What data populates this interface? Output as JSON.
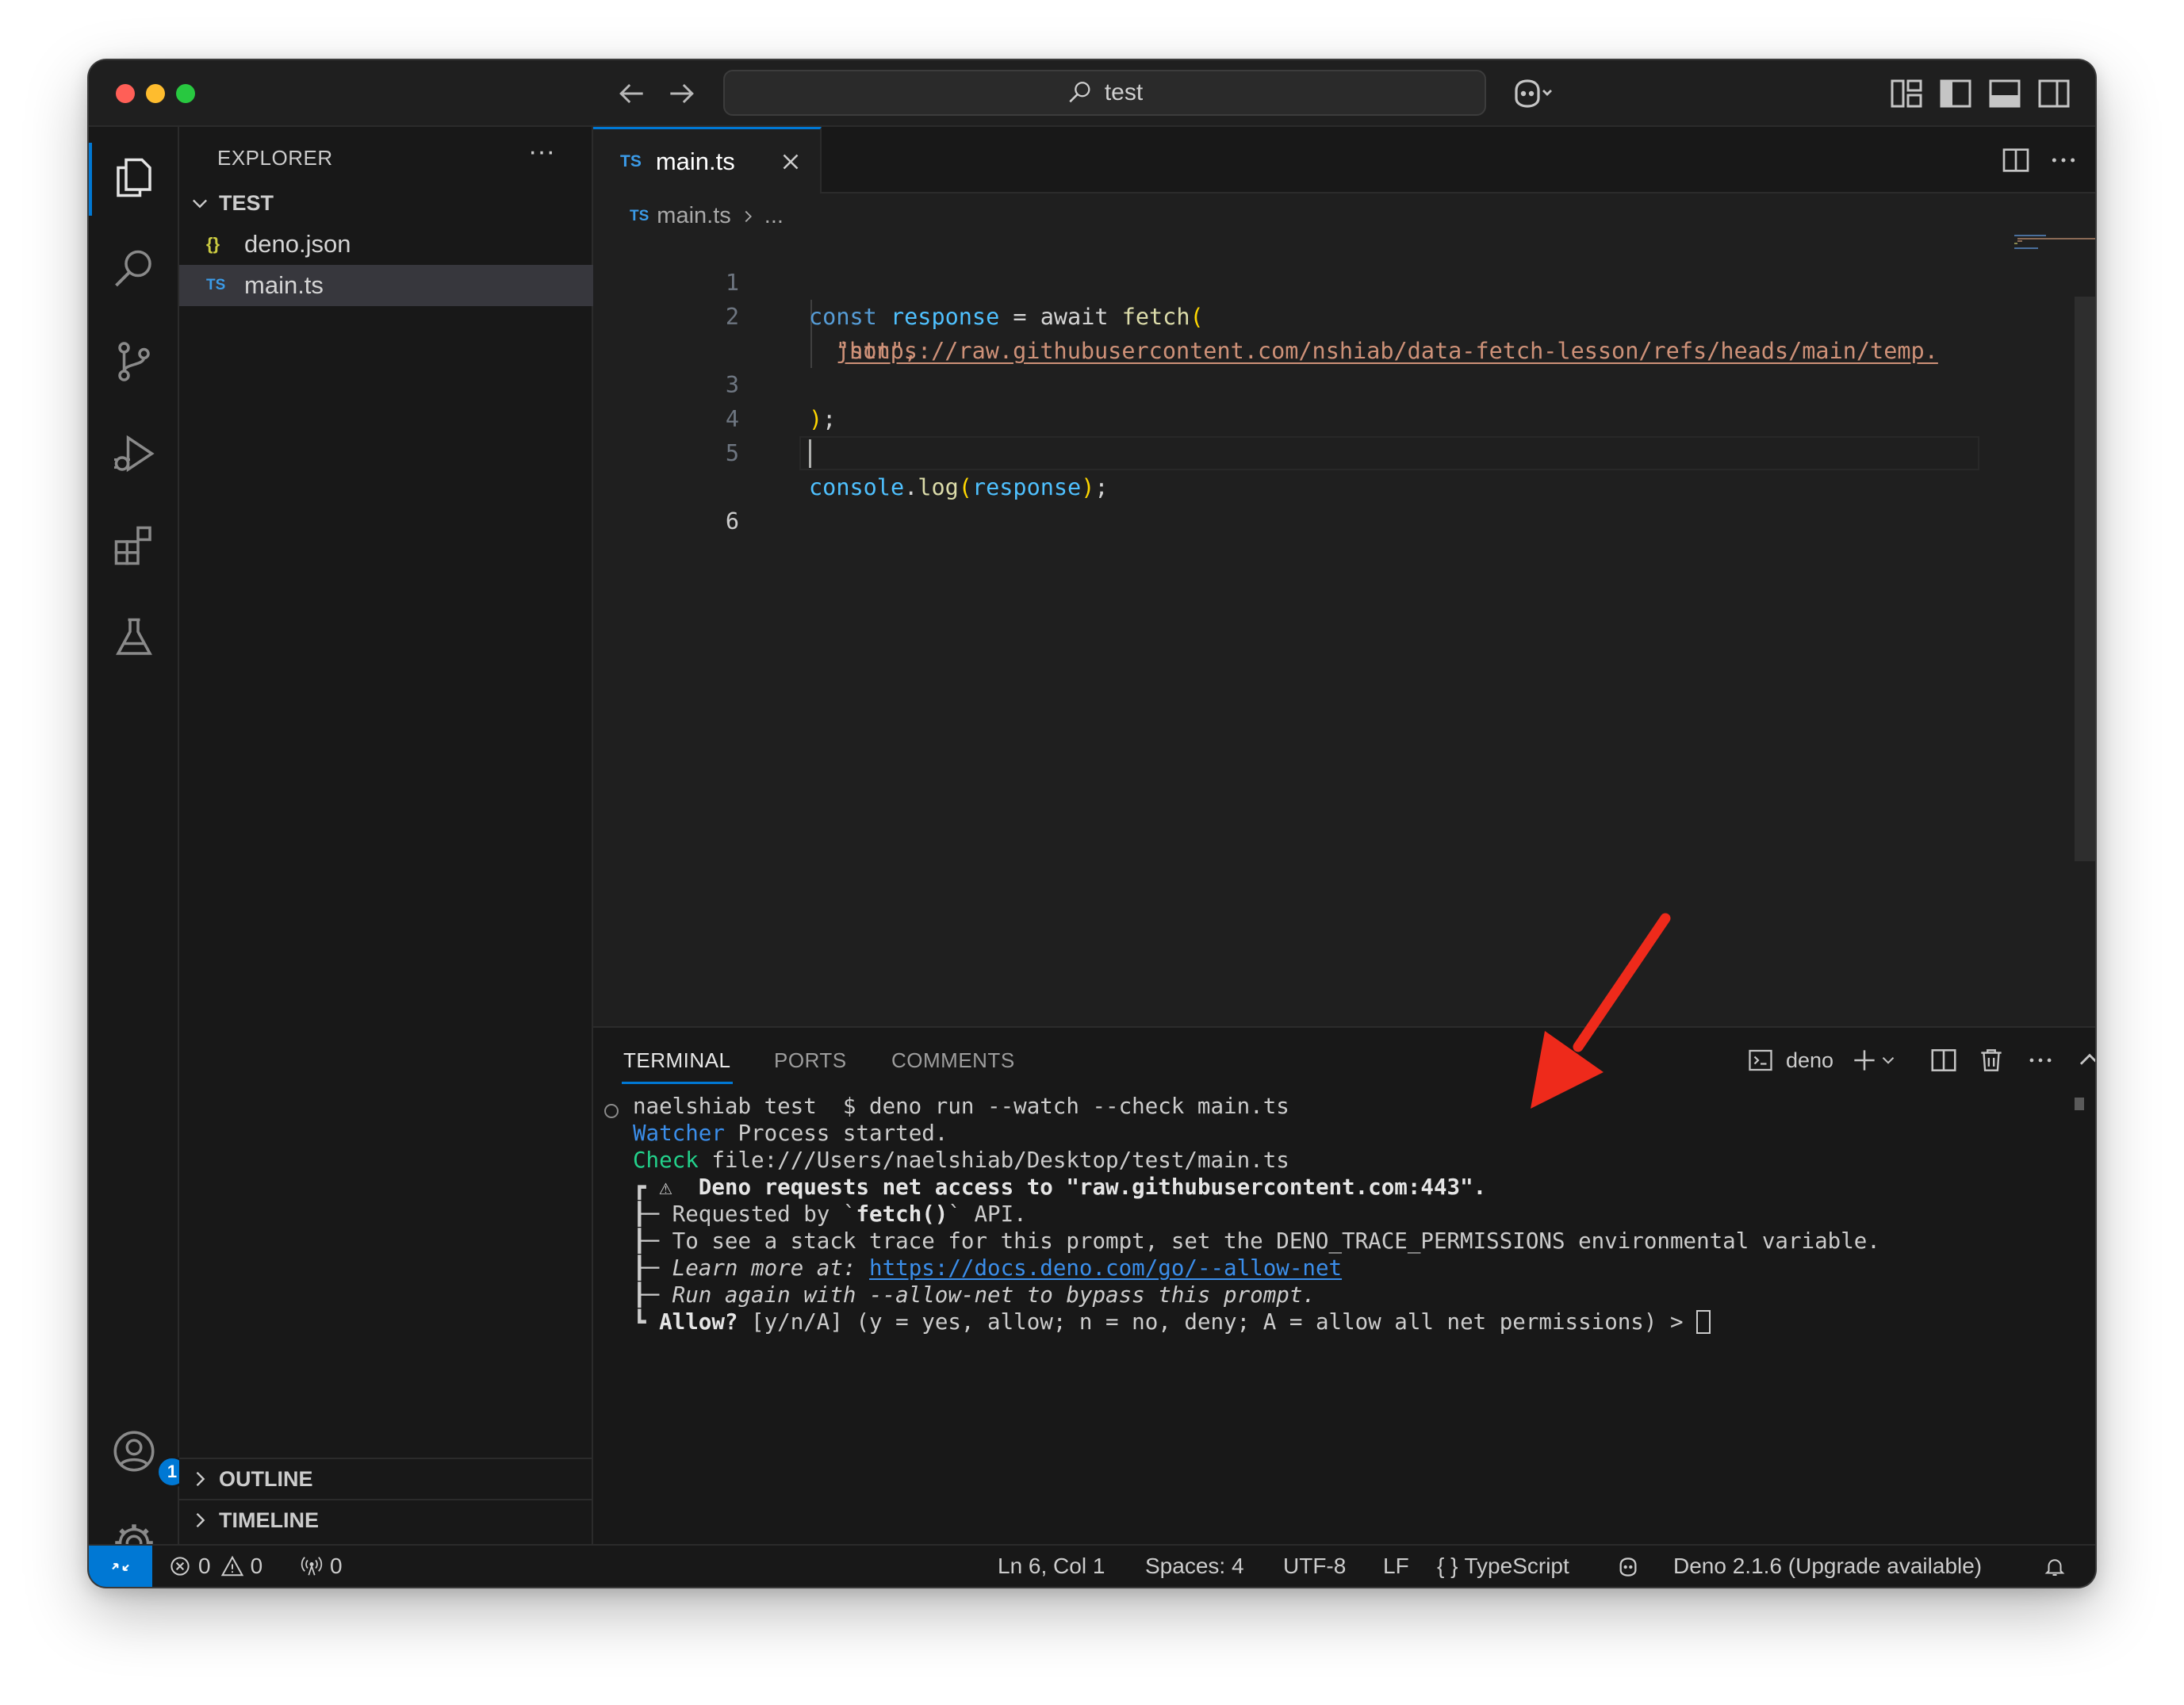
{
  "titlebar": {
    "search_text": "test"
  },
  "activity_bar": {
    "account_badge_count": "1"
  },
  "sidebar": {
    "title": "EXPLORER",
    "more": "···",
    "folder_name": "TEST",
    "files": [
      {
        "name": "deno.json",
        "icon": "{}",
        "icon_color": "#cbcb41"
      },
      {
        "name": "main.ts",
        "icon": "TS",
        "icon_color": "#3b9be8"
      }
    ],
    "outline_label": "OUTLINE",
    "timeline_label": "TIMELINE"
  },
  "editor": {
    "tab_badge": "TS",
    "tab_label": "main.ts",
    "breadcrumb_badge": "TS",
    "breadcrumb_file": "main.ts",
    "breadcrumb_more": "...",
    "line_numbers": [
      "1",
      "2",
      "3",
      "4",
      "5",
      "6"
    ],
    "code": {
      "l1_kw": "const",
      "l1_var": "response",
      "l1_eq": " = await ",
      "l1_fn": "fetch",
      "l1_paren": "(",
      "l2_quote": "\"",
      "l2_url": "https://raw.githubusercontent.com/nshiab/data-fetch-lesson/refs/heads/main/temp.",
      "l2b_url": "json",
      "l2b_rest": "\",",
      "l3_paren": ")",
      "l3_semi": ";",
      "l5_obj": "console",
      "l5_dot": ".",
      "l5_fn": "log",
      "l5_open": "(",
      "l5_var": "response",
      "l5_close": ")",
      "l5_semi": ";"
    }
  },
  "panel": {
    "tabs": [
      "TERMINAL",
      "PORTS",
      "COMMENTS"
    ],
    "active_tab": "TERMINAL",
    "shell_label": "deno",
    "terminal": {
      "line1": "naelshiab test  $ deno run --watch --check main.ts",
      "line2_tag": "Watcher",
      "line2_rest": " Process started.",
      "line3_tag": "Check",
      "line3_rest": " file:///Users/naelshiab/Desktop/test/main.ts",
      "line4_tree": "┏ ⚠  ",
      "line4_text": "Deno requests net access to \"raw.githubusercontent.com:443\".",
      "line5_tree": "┠─ ",
      "line5_pre": "Requested by `",
      "line5_bold": "fetch()",
      "line5_post": "` API.",
      "line6_tree": "┠─ ",
      "line6_text": "To see a stack trace for this prompt, set the DENO_TRACE_PERMISSIONS environmental variable.",
      "line7_tree": "┠─ ",
      "line7_text": "Learn more at: ",
      "line7_link": "https://docs.deno.com/go/--allow-net",
      "line8_tree": "┠─ ",
      "line8_text": "Run again with --allow-net to bypass this prompt.",
      "line9_tree": "┗ ",
      "line9_bold": "Allow?",
      "line9_text": " [y/n/A] (y = yes, allow; n = no, deny; A = allow all net permissions) > "
    }
  },
  "statusbar": {
    "errors": "0",
    "warnings": "0",
    "ports": "0",
    "position": "Ln 6, Col 1",
    "spaces": "Spaces: 4",
    "encoding": "UTF-8",
    "eol": "LF",
    "language_braces": "{ }",
    "language": "TypeScript",
    "deno_version": "Deno 2.1.6 (Upgrade available)"
  },
  "colors": {
    "accent": "#0078d4",
    "annotation_arrow": "#ee2a1b",
    "close_dot": "#ff5f57",
    "minimize_dot": "#febc2e",
    "maximize_dot": "#28c840"
  }
}
